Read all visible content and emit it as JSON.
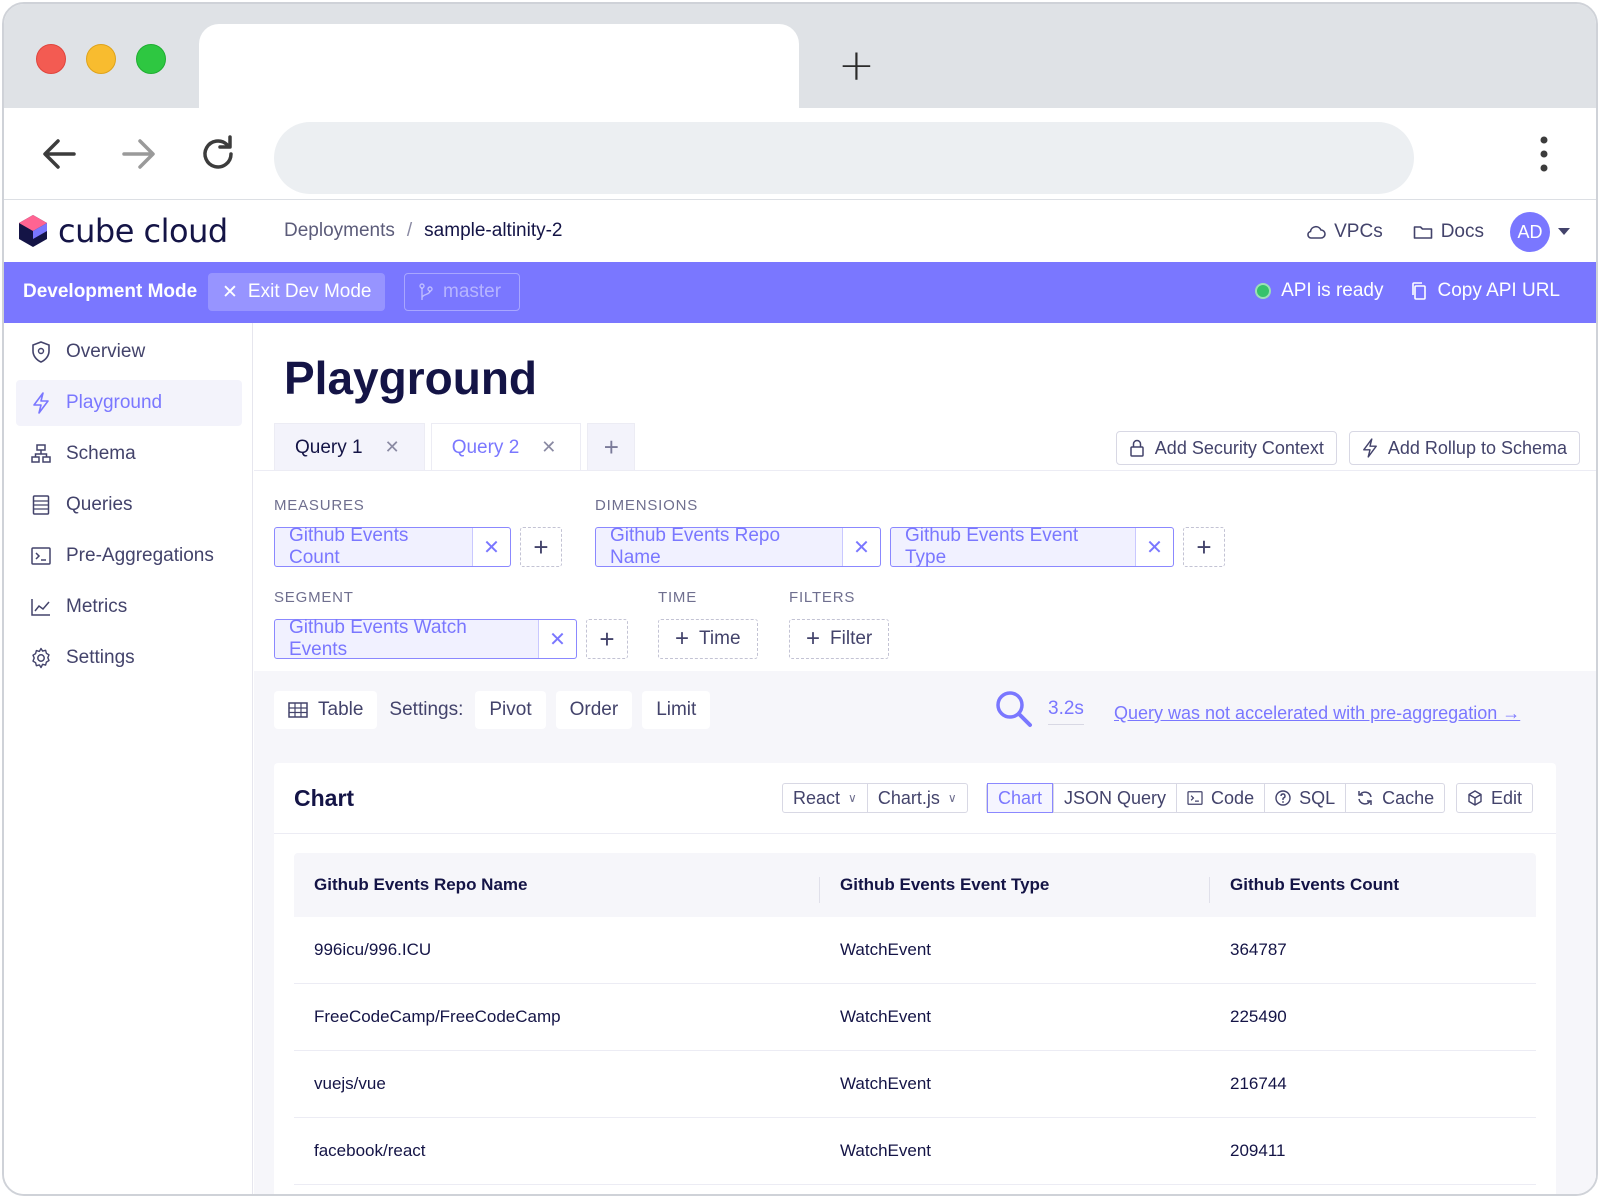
{
  "app": {
    "logo_text": "cube cloud",
    "breadcrumb": {
      "parent": "Deployments",
      "separator": "/",
      "current": "sample-altinity-2"
    },
    "header_links": {
      "vpcs": "VPCs",
      "docs": "Docs"
    },
    "avatar_initials": "AD"
  },
  "devbar": {
    "title": "Development Mode",
    "exit_label": "Exit Dev Mode",
    "branch_label": "master",
    "api_status": "API is ready",
    "copy_api_label": "Copy API URL",
    "accent_color": "#7a77ff",
    "status_color": "#36c26b"
  },
  "sidebar": {
    "items": [
      {
        "label": "Overview",
        "icon": "shield-icon"
      },
      {
        "label": "Playground",
        "icon": "lightning-icon",
        "active": true
      },
      {
        "label": "Schema",
        "icon": "schema-icon"
      },
      {
        "label": "Queries",
        "icon": "list-icon"
      },
      {
        "label": "Pre-Aggregations",
        "icon": "terminal-icon"
      },
      {
        "label": "Metrics",
        "icon": "chart-icon"
      },
      {
        "label": "Settings",
        "icon": "gear-icon"
      }
    ]
  },
  "main": {
    "title": "Playground",
    "query_tabs": [
      {
        "label": "Query 1",
        "active": false
      },
      {
        "label": "Query 2",
        "active": true
      }
    ],
    "add_security_context": "Add Security Context",
    "add_rollup": "Add Rollup to Schema",
    "builder": {
      "measures_label": "MEASURES",
      "measures": [
        "Github Events Count"
      ],
      "dimensions_label": "DIMENSIONS",
      "dimensions": [
        "Github Events Repo Name",
        "Github Events Event Type"
      ],
      "segment_label": "SEGMENT",
      "segments": [
        "Github Events Watch Events"
      ],
      "time_label": "TIME",
      "time_button": "Time",
      "filters_label": "FILTERS",
      "filter_button": "Filter"
    },
    "settings_bar": {
      "view": "Table",
      "settings_label": "Settings:",
      "pivot": "Pivot",
      "order": "Order",
      "limit": "Limit",
      "duration": "3.2s",
      "accel_link": "Query was not accelerated with pre-aggregation →"
    },
    "chart_card": {
      "title": "Chart",
      "framework": "React",
      "library": "Chart.js",
      "tabs": [
        "Chart",
        "JSON Query",
        "Code",
        "SQL",
        "Cache"
      ],
      "edit": "Edit",
      "table": {
        "columns": [
          "Github Events Repo Name",
          "Github Events Event Type",
          "Github Events Count"
        ],
        "rows": [
          [
            "996icu/996.ICU",
            "WatchEvent",
            "364787"
          ],
          [
            "FreeCodeCamp/FreeCodeCamp",
            "WatchEvent",
            "225490"
          ],
          [
            "vuejs/vue",
            "WatchEvent",
            "216744"
          ],
          [
            "facebook/react",
            "WatchEvent",
            "209411"
          ]
        ]
      }
    }
  }
}
